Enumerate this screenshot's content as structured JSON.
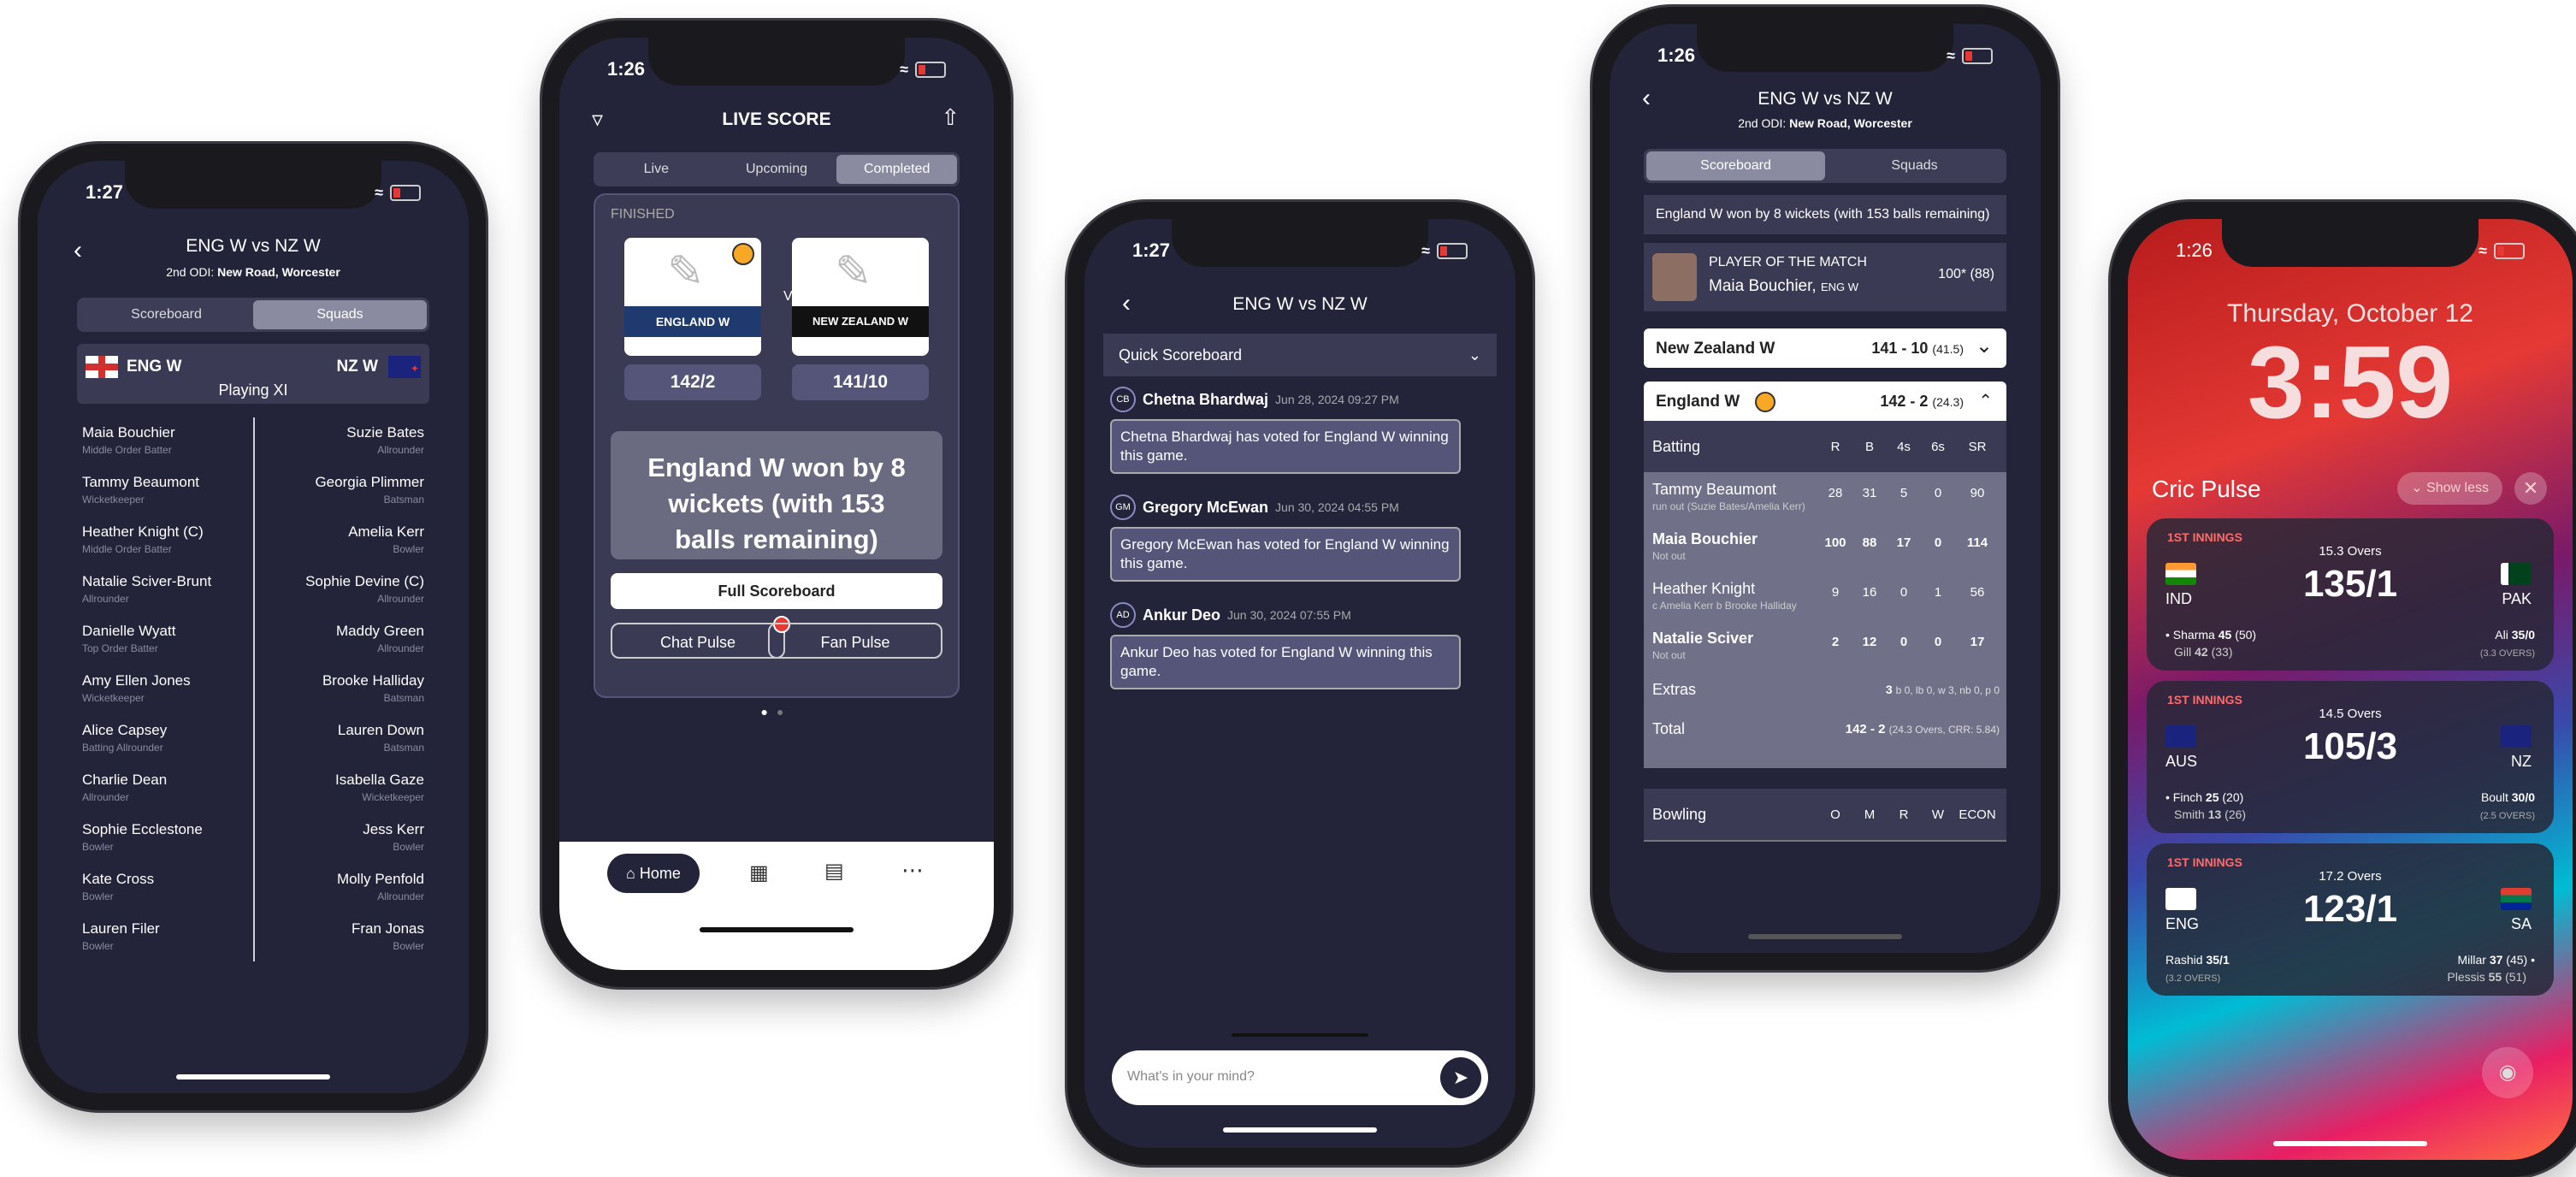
{
  "phone1": {
    "time": "1:27",
    "title": "ENG W vs NZ W",
    "subtitle_prefix": "2nd ODI: ",
    "subtitle_venue": "New Road, Worcester",
    "tabs": [
      "Scoreboard",
      "Squads"
    ],
    "team_left": "ENG W",
    "team_right": "NZ W",
    "playing_xi": "Playing XI",
    "left_players": [
      {
        "name": "Maia Bouchier",
        "role": "Middle Order Batter"
      },
      {
        "name": "Tammy Beaumont",
        "role": "Wicketkeeper"
      },
      {
        "name": "Heather Knight (C)",
        "role": "Middle Order Batter"
      },
      {
        "name": "Natalie Sciver-Brunt",
        "role": "Allrounder"
      },
      {
        "name": "Danielle Wyatt",
        "role": "Top Order Batter"
      },
      {
        "name": "Amy Ellen Jones",
        "role": "Wicketkeeper"
      },
      {
        "name": "Alice Capsey",
        "role": "Batting Allrounder"
      },
      {
        "name": "Charlie Dean",
        "role": "Allrounder"
      },
      {
        "name": "Sophie Ecclestone",
        "role": "Bowler"
      },
      {
        "name": "Kate Cross",
        "role": "Bowler"
      },
      {
        "name": "Lauren Filer",
        "role": "Bowler"
      }
    ],
    "right_players": [
      {
        "name": "Suzie Bates",
        "role": "Allrounder"
      },
      {
        "name": "Georgia Plimmer",
        "role": "Batsman"
      },
      {
        "name": "Amelia Kerr",
        "role": "Bowler"
      },
      {
        "name": "Sophie Devine (C)",
        "role": "Allrounder"
      },
      {
        "name": "Maddy Green",
        "role": "Allrounder"
      },
      {
        "name": "Brooke Halliday",
        "role": "Batsman"
      },
      {
        "name": "Lauren Down",
        "role": "Batsman"
      },
      {
        "name": "Isabella Gaze",
        "role": "Wicketkeeper"
      },
      {
        "name": "Jess Kerr",
        "role": "Bowler"
      },
      {
        "name": "Molly Penfold",
        "role": "Allrounder"
      },
      {
        "name": "Fran Jonas",
        "role": "Bowler"
      }
    ]
  },
  "phone2": {
    "time": "1:26",
    "title": "LIVE SCORE",
    "tabs": [
      "Live",
      "Upcoming",
      "Completed"
    ],
    "status": "FINISHED",
    "team_left": "ENGLAND W",
    "team_right": "NEW ZEALAND W",
    "vs": "VS",
    "score_left": "142/2",
    "score_right": "141/10",
    "result": "England W won by 8 wickets (with 153 balls remaining)",
    "full_scoreboard": "Full Scoreboard",
    "chat_pulse": "Chat Pulse",
    "fan_pulse": "Fan Pulse",
    "nav_home": "Home"
  },
  "phone3": {
    "time": "1:27",
    "title": "ENG W vs NZ W",
    "quick_scoreboard": "Quick Scoreboard",
    "messages": [
      {
        "initials": "CB",
        "name": "Chetna Bhardwaj",
        "time": "Jun 28, 2024 09:27 PM",
        "text": "Chetna Bhardwaj has voted for England W winning this game."
      },
      {
        "initials": "GM",
        "name": "Gregory McEwan",
        "time": "Jun 30, 2024 04:55 PM",
        "text": "Gregory McEwan has voted for England W winning this game."
      },
      {
        "initials": "AD",
        "name": "Ankur Deo",
        "time": "Jun 30, 2024 07:55 PM",
        "text": "Ankur Deo has voted for England W winning this game."
      }
    ],
    "input_placeholder": "What's in your mind?"
  },
  "phone4": {
    "time": "1:26",
    "title": "ENG W vs NZ W",
    "subtitle_prefix": "2nd ODI: ",
    "subtitle_venue": "New Road, Worcester",
    "tabs": [
      "Scoreboard",
      "Squads"
    ],
    "result": "England W won by 8 wickets (with 153 balls remaining)",
    "potm_label": "PLAYER OF THE MATCH",
    "potm_name": "Maia Bouchier,",
    "potm_team": "ENG W",
    "potm_score": "100* (88)",
    "innings": [
      {
        "team": "New Zealand W",
        "score": "141 - 10",
        "overs": "(41.5)"
      },
      {
        "team": "England W",
        "score": "142 - 2",
        "overs": "(24.3)"
      }
    ],
    "batting_label": "Batting",
    "batting_cols": [
      "R",
      "B",
      "4s",
      "6s",
      "SR"
    ],
    "batters": [
      {
        "name": "Tammy Beaumont",
        "dismissal": "run out (Suzie Bates/Amelia Kerr)",
        "stats": [
          "28",
          "31",
          "5",
          "0",
          "90"
        ]
      },
      {
        "name": "Maia Bouchier",
        "dismissal": "Not out",
        "stats": [
          "100",
          "88",
          "17",
          "0",
          "114"
        ]
      },
      {
        "name": "Heather Knight",
        "dismissal": "c Amelia Kerr b Brooke Halliday",
        "stats": [
          "9",
          "16",
          "0",
          "1",
          "56"
        ]
      },
      {
        "name": "Natalie Sciver",
        "dismissal": "Not out",
        "stats": [
          "2",
          "12",
          "0",
          "0",
          "17"
        ]
      }
    ],
    "extras_label": "Extras",
    "extras_value": "3",
    "extras_detail": "b 0, lb 0, w 3, nb 0, p 0",
    "total_label": "Total",
    "total_value": "142 - 2",
    "total_detail": "(24.3 Overs, CRR: 5.84)",
    "bowling_label": "Bowling",
    "bowling_cols": [
      "O",
      "M",
      "R",
      "W",
      "ECON"
    ]
  },
  "phone5": {
    "time": "1:26",
    "date": "Thursday, October 12",
    "clock": "3:59",
    "widget_title": "Cric Pulse",
    "show_less": "Show less",
    "cards": [
      {
        "innings": "1ST INNINGS",
        "overs": "15.3 Overs",
        "team_left": "IND",
        "team_right": "PAK",
        "score": "135/1",
        "b1": "Sharma",
        "b1r": "45",
        "b1b": "(50)",
        "b2": "Gill",
        "b2r": "42",
        "b2b": "(33)",
        "bowler": "Ali",
        "bowler_fig": "35/0",
        "bowler_ov": "(3.3 OVERS)"
      },
      {
        "innings": "1ST INNINGS",
        "overs": "14.5 Overs",
        "team_left": "AUS",
        "team_right": "NZ",
        "score": "105/3",
        "b1": "Finch",
        "b1r": "25",
        "b1b": "(20)",
        "b2": "Smith",
        "b2r": "13",
        "b2b": "(26)",
        "bowler": "Boult",
        "bowler_fig": "30/0",
        "bowler_ov": "(2.5 OVERS)"
      },
      {
        "innings": "1ST INNINGS",
        "overs": "17.2 Overs",
        "team_left": "ENG",
        "team_right": "SA",
        "score": "123/1",
        "bowler": "Rashid",
        "bowler_fig": "35/1",
        "bowler_ov": "(3.2 OVERS)",
        "b1": "Millar",
        "b1r": "37",
        "b1b": "(45)",
        "b2": "Plessis",
        "b2r": "55",
        "b2b": "(51)"
      }
    ]
  }
}
